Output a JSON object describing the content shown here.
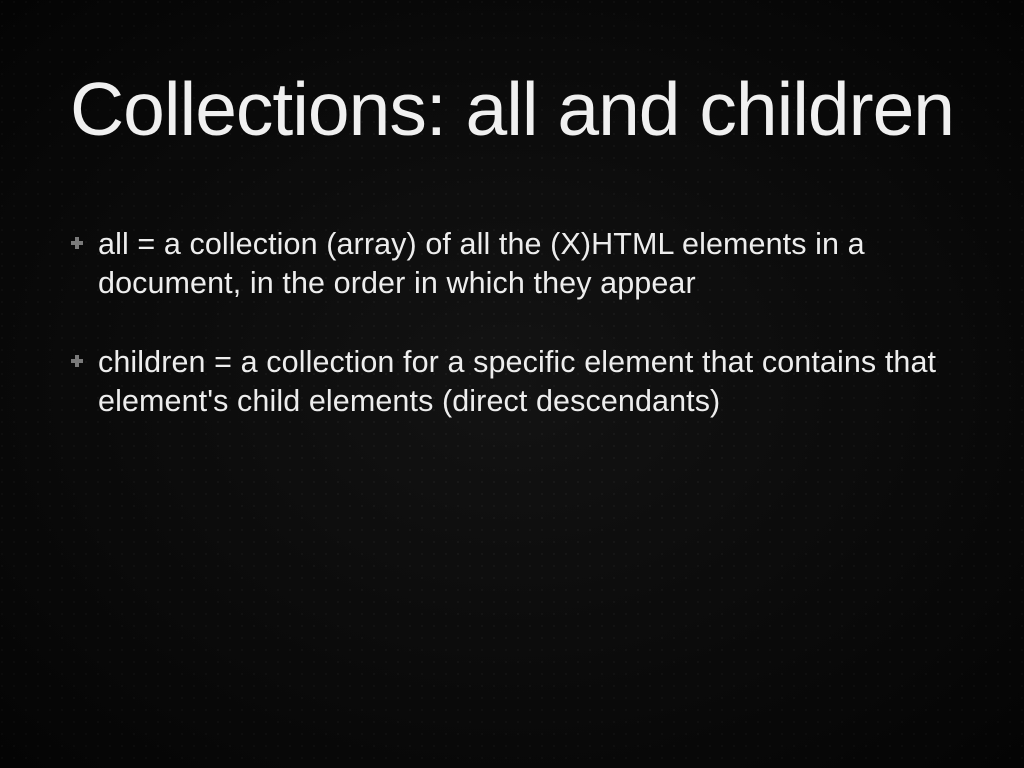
{
  "slide": {
    "title": "Collections: all and children",
    "bullets": [
      "all = a collection (array) of all the (X)HTML elements in a document, in the order in which they appear",
      "children = a collection for a specific element that contains that element's child elements (direct descendants)"
    ]
  }
}
